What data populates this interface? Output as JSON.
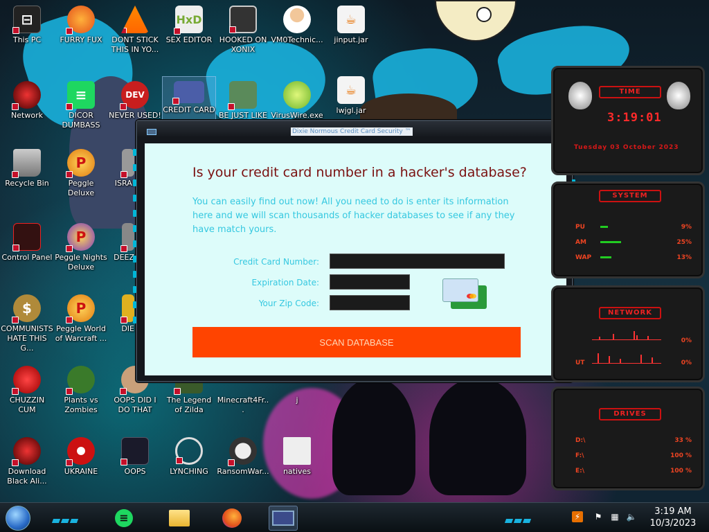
{
  "desktop": {
    "icons": [
      {
        "label": "This PC"
      },
      {
        "label": "FURRY FUX"
      },
      {
        "label": "DONT STICK THIS IN YO..."
      },
      {
        "label": "SEX EDITOR"
      },
      {
        "label": "HOOKED ON XONIX"
      },
      {
        "label": "VM0Technic..."
      },
      {
        "label": "jinput.jar"
      },
      {
        "label": "Network"
      },
      {
        "label": "DICOR DUMBASS"
      },
      {
        "label": "NEVER USED!"
      },
      {
        "label": "CREDIT CARD"
      },
      {
        "label": "BE JUST LIKE"
      },
      {
        "label": "VirusWire.exe"
      },
      {
        "label": "lwjgl.jar"
      },
      {
        "label": "Recycle Bin"
      },
      {
        "label": "Peggle Deluxe"
      },
      {
        "label": "ISRAI"
      },
      {
        "label": "Control Panel"
      },
      {
        "label": "Peggle Nights Deluxe"
      },
      {
        "label": "DEEZ"
      },
      {
        "label": "COMMUNISTS HATE THIS G..."
      },
      {
        "label": "Peggle World of Warcraft ..."
      },
      {
        "label": "DIE"
      },
      {
        "label": "CHUZZIN CUM"
      },
      {
        "label": "Plants vs Zombies"
      },
      {
        "label": "OOPS DID I DO THAT"
      },
      {
        "label": "The Legend of Zilda"
      },
      {
        "label": "Minecraft4Fr..."
      },
      {
        "label": "j"
      },
      {
        "label": "Download Black Ali..."
      },
      {
        "label": "UKRAINE"
      },
      {
        "label": "OOPS"
      },
      {
        "label": "LYNCHING"
      },
      {
        "label": "RansomWar..."
      },
      {
        "label": "natives"
      }
    ]
  },
  "window": {
    "title": "Dixie Normous Credit Card Security ™",
    "heading": "Is your credit card number in a hacker's database?",
    "description": "You can easily find out now! All you need to do is enter its information here and we will scan thousands of hacker databases to see if any they have match yours.",
    "fields": {
      "card_number_label": "Credit Card Number:",
      "card_number_value": "",
      "expiration_label": "Expiration Date:",
      "expiration_value": "",
      "zip_label": "Your Zip Code:",
      "zip_value": ""
    },
    "scan_button": "SCAN DATABASE"
  },
  "gadgets": {
    "time": {
      "header": "TIME",
      "clock": "3:19:01",
      "date": "Tuesday 03 October 2023"
    },
    "system": {
      "header": "SYSTEM",
      "rows": [
        {
          "label": "PU",
          "value": "9%",
          "level": 0.09
        },
        {
          "label": "AM",
          "value": "25%",
          "level": 0.25
        },
        {
          "label": "WAP",
          "value": "13%",
          "level": 0.13
        }
      ]
    },
    "network": {
      "header": "NETWORK",
      "rows": [
        {
          "label": "",
          "value": "0%"
        },
        {
          "label": "UT",
          "value": "0%"
        }
      ]
    },
    "drives": {
      "header": "DRIVES",
      "rows": [
        {
          "label": "D:\\",
          "value": "33 %"
        },
        {
          "label": "F:\\",
          "value": "100 %"
        },
        {
          "label": "E:\\",
          "value": "100 %"
        }
      ]
    }
  },
  "taskbar": {
    "time": "3:19 AM",
    "date": "10/3/2023",
    "tray_icons": [
      "security-icon",
      "flag-icon",
      "network-icon",
      "volume-icon"
    ]
  },
  "colors": {
    "window_bg": "#ddfcfa",
    "heading": "#7a1010",
    "accent_text": "#35c8e0",
    "scan_button": "#ff4400",
    "gadget_red": "#ff2a2a",
    "taskbar_accent": "#19b3e0"
  }
}
